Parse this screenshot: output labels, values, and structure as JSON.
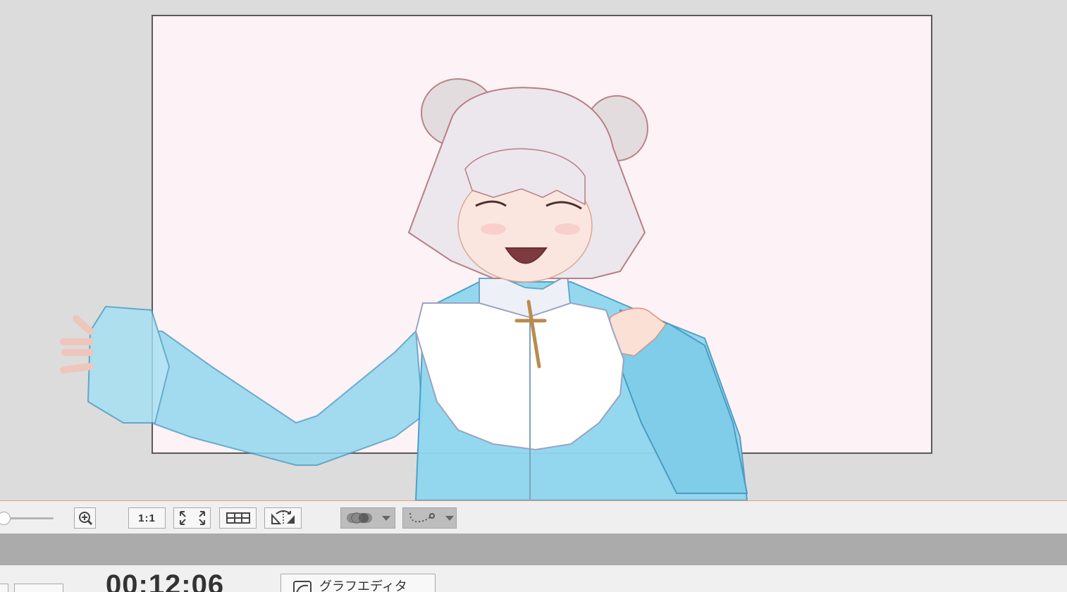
{
  "toolbar": {
    "zoom_icon": "zoom-in-icon",
    "ratio_label": "1:1",
    "fit_icon": "fit-to-window-icon",
    "grid_icon": "grid-icon",
    "flip_icon": "flip-icon",
    "onion_icon": "onion-skin-icon",
    "path_icon": "motion-path-icon"
  },
  "timeline": {
    "timecode": "00:12:06",
    "graph_editor_label": "グラフエディタ"
  },
  "colors": {
    "canvas_bg": "#fdf2f6",
    "workspace_bg": "#dcdcdc",
    "accent_line": "#e8a17a",
    "sleeve_blue": "#8fd7ef"
  }
}
